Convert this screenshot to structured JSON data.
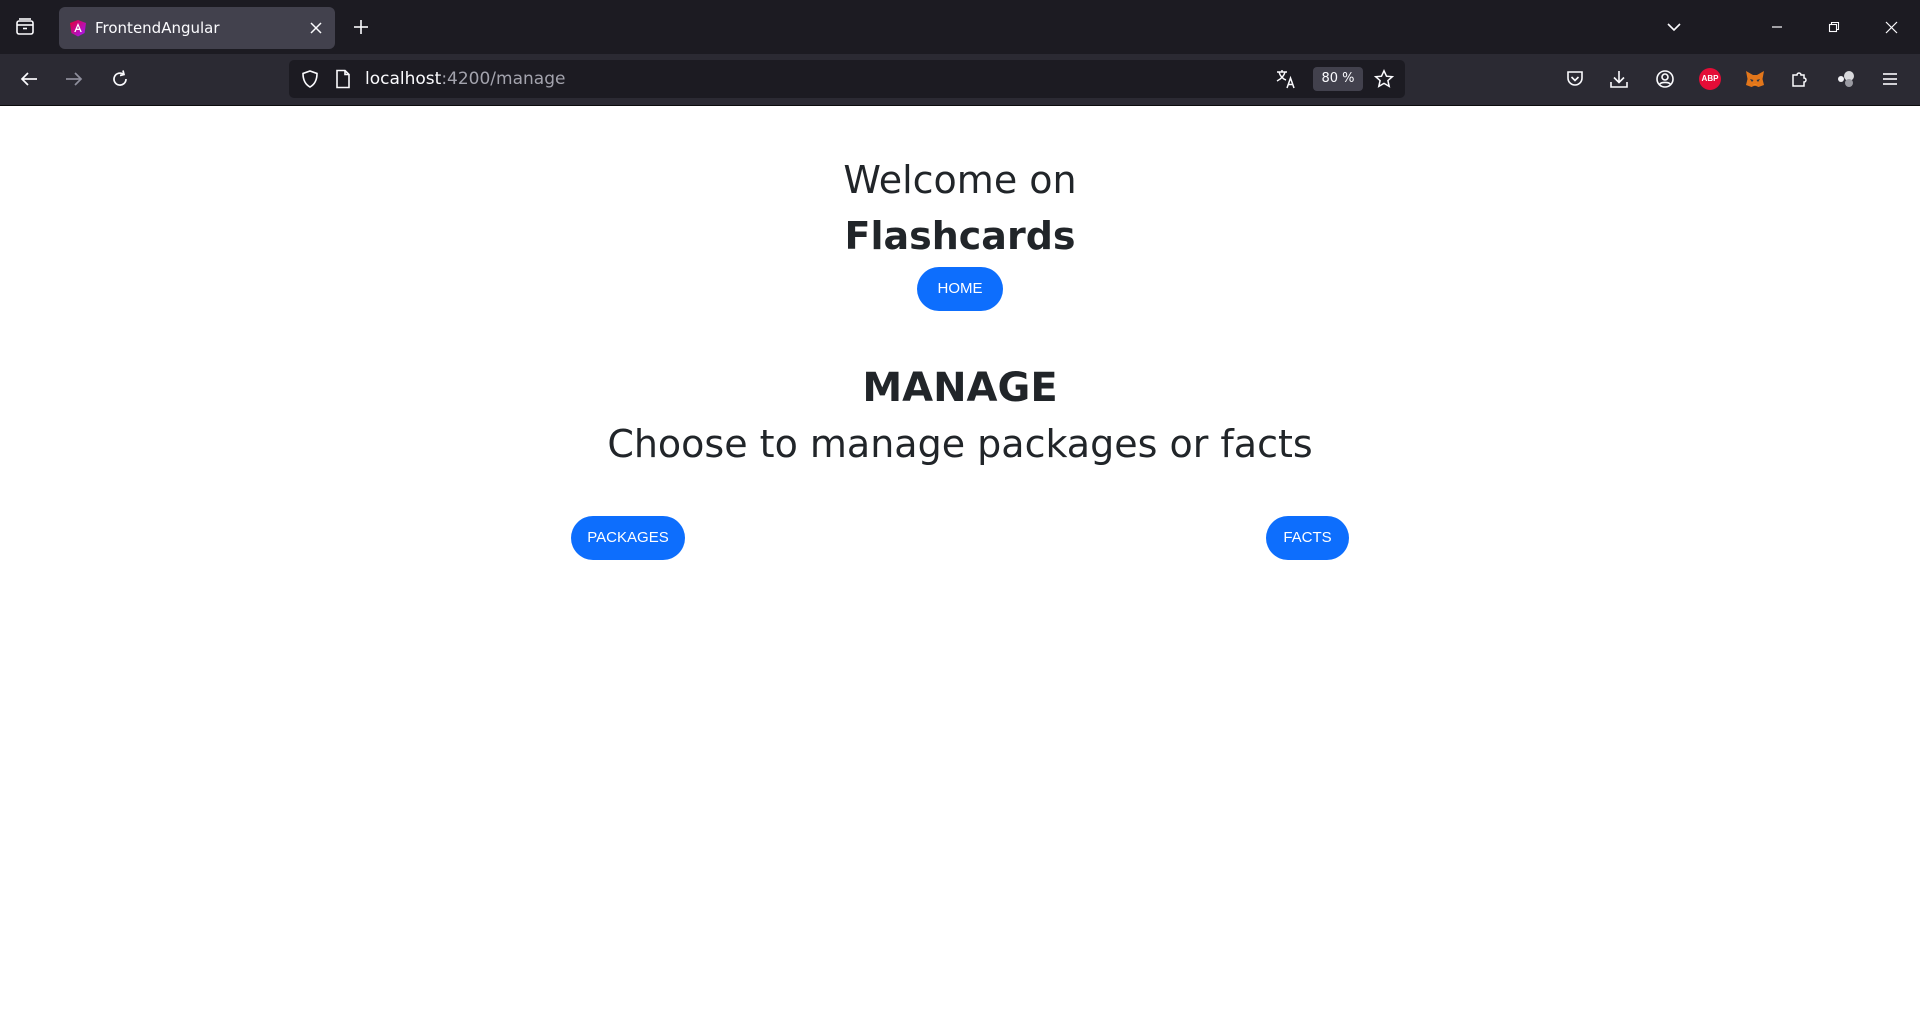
{
  "browser": {
    "tab": {
      "title": "FrontendAngular",
      "favicon": "angular-icon"
    },
    "url": {
      "host": "localhost",
      "path": ":4200/manage"
    },
    "zoom": "80 %",
    "extensions": {
      "adblock_label": "ABP"
    }
  },
  "page": {
    "welcome": "Welcome on",
    "brand": "Flashcards",
    "home_button": "HOME",
    "manage_title": "MANAGE",
    "manage_subtitle": "Choose to manage packages or facts",
    "packages_button": "PACKAGES",
    "facts_button": "FACTS"
  },
  "colors": {
    "primary": "#0d6efd",
    "text": "#212529",
    "tabstrip": "#1c1b22",
    "toolbar": "#2b2a33",
    "tab_active": "#42414d"
  }
}
